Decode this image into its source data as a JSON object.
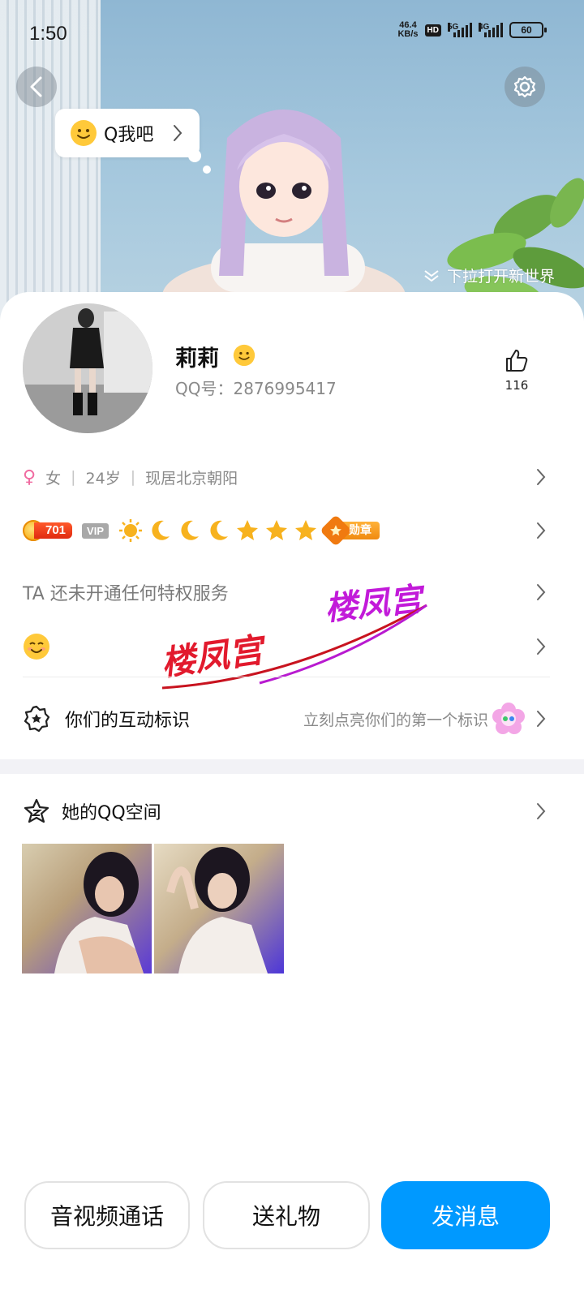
{
  "status_bar": {
    "time": "1:50",
    "net_speed_value": "46.4",
    "net_speed_unit": "KB/s",
    "hd_label": "HD",
    "signal1_label": "5G",
    "signal2_label": "4G",
    "battery": "60"
  },
  "hero": {
    "bubble_text": "Q我吧",
    "pull_hint": "下拉打开新世界"
  },
  "profile": {
    "name": "莉莉",
    "qq_number": "QQ号：2876995417",
    "like_count": "116"
  },
  "info": {
    "gender_symbol": "♀",
    "gender": "女",
    "age": "24岁",
    "location": "现居北京朝阳"
  },
  "badges": {
    "coin_level": "701",
    "vip_tag": "VIP",
    "medal_label": "勋章"
  },
  "privilege_text": "TA 还未开通任何特权服务",
  "interaction": {
    "label": "你们的互动标识",
    "hint": "立刻点亮你们的第一个标识"
  },
  "qzone": {
    "label": "她的QQ空间"
  },
  "watermarks": [
    "楼凤宫",
    "楼凤宫"
  ],
  "actions": {
    "call": "音视频通话",
    "gift": "送礼物",
    "message": "发消息"
  },
  "colors": {
    "accent": "#0099ff",
    "gender_pink": "#f06aa0"
  }
}
